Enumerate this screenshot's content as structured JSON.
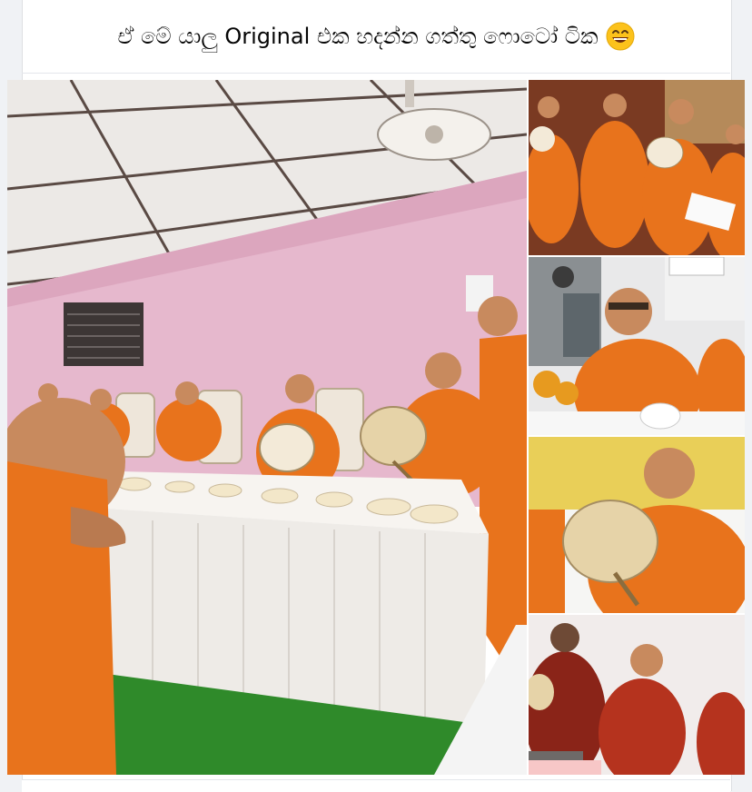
{
  "post": {
    "caption": "ඒ මේ යාලු  Original එක හදන්න ගත්තු ෆොටෝ ටික",
    "caption_emoji": "grinning-face-with-smiling-eyes-icon"
  },
  "colors": {
    "robe_orange": "#e8731c",
    "wall_pink": "#e9bcd0",
    "tablecloth": "#f2f0ee",
    "turf_green": "#2f8a2a",
    "fan_beige": "#e6d3a8"
  },
  "photos": [
    {
      "name": "photo-main-dining-table"
    },
    {
      "name": "photo-monks-seated-ceremony"
    },
    {
      "name": "photo-monk-with-media"
    },
    {
      "name": "photo-monk-with-fan"
    },
    {
      "name": "photo-monks-maroon-robes"
    }
  ]
}
